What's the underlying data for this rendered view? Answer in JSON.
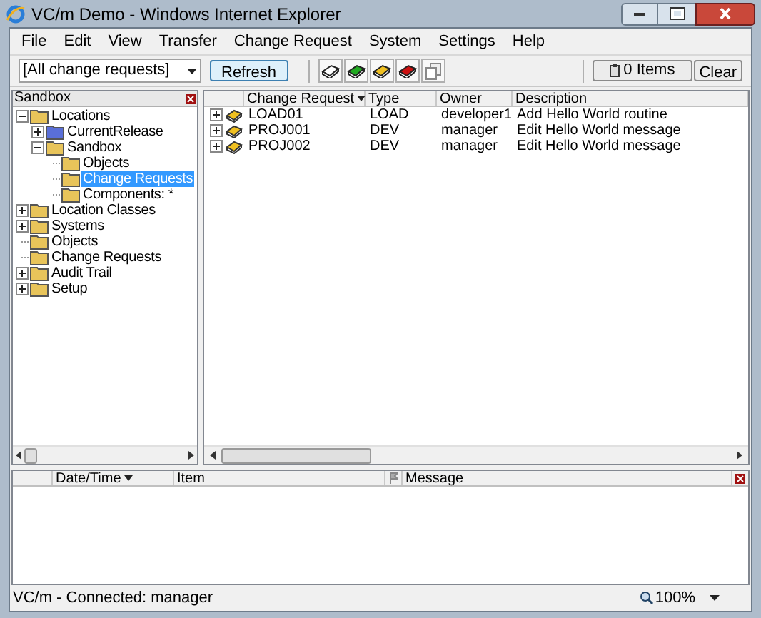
{
  "window": {
    "title": "VC/m Demo - Windows Internet Explorer"
  },
  "menu": [
    "File",
    "Edit",
    "View",
    "Transfer",
    "Change Request",
    "System",
    "Settings",
    "Help"
  ],
  "toolbar": {
    "filter": {
      "value": "[All change requests]"
    },
    "refresh": "Refresh",
    "icon_buttons": [
      {
        "kind": "book",
        "color": "#ffffff"
      },
      {
        "kind": "book",
        "color": "#22aa22"
      },
      {
        "kind": "book",
        "color": "#f0c020"
      },
      {
        "kind": "book",
        "color": "#cc1111"
      },
      {
        "kind": "copy"
      }
    ],
    "items_button": "0 Items",
    "clear": "Clear"
  },
  "tree": {
    "title": "Sandbox",
    "items": [
      {
        "label": "Locations",
        "kind": "branch",
        "expanded": true,
        "color": "#e8c45a",
        "selected": false,
        "children": [
          {
            "label": "CurrentRelease",
            "kind": "branch",
            "expanded": false,
            "color": "#5a6fd8",
            "selected": false
          },
          {
            "label": "Sandbox",
            "kind": "branch",
            "expanded": true,
            "color": "#e8c45a",
            "selected": false,
            "children": [
              {
                "label": "Objects",
                "kind": "leaf",
                "color": "#e8c45a",
                "selected": false
              },
              {
                "label": "Change Requests",
                "kind": "leaf",
                "color": "#e8c45a",
                "selected": true
              },
              {
                "label": "Components: *",
                "kind": "leaf",
                "color": "#e8c45a",
                "selected": false
              }
            ]
          }
        ]
      },
      {
        "label": "Location Classes",
        "kind": "branch",
        "expanded": false,
        "color": "#e8c45a",
        "selected": false
      },
      {
        "label": "Systems",
        "kind": "branch",
        "expanded": false,
        "color": "#e8c45a",
        "selected": false
      },
      {
        "label": "Objects",
        "kind": "leaf",
        "color": "#e8c45a",
        "selected": false
      },
      {
        "label": "Change Requests",
        "kind": "leaf",
        "color": "#e8c45a",
        "selected": false
      },
      {
        "label": "Audit Trail",
        "kind": "branch",
        "expanded": false,
        "color": "#e8c45a",
        "selected": false
      },
      {
        "label": "Setup",
        "kind": "branch",
        "expanded": false,
        "color": "#e8c45a",
        "selected": false
      }
    ]
  },
  "table": {
    "columns": [
      {
        "label": "Change Request",
        "sorted": true
      },
      {
        "label": "Type",
        "sorted": false
      },
      {
        "label": "Owner",
        "sorted": false
      },
      {
        "label": "Description",
        "sorted": false
      }
    ],
    "rows": [
      {
        "expanded": false,
        "cells": [
          "LOAD01",
          "LOAD",
          "developer1",
          "Add Hello World routine"
        ]
      },
      {
        "expanded": false,
        "cells": [
          "PROJ001",
          "DEV",
          "manager",
          "Edit Hello World message"
        ]
      },
      {
        "expanded": false,
        "cells": [
          "PROJ002",
          "DEV",
          "manager",
          "Edit Hello World message"
        ]
      }
    ]
  },
  "log": {
    "columns": [
      {
        "label": "Date/Time",
        "sorted": true
      },
      {
        "label": "Item",
        "sorted": false
      },
      {
        "label": "Message",
        "sorted": false
      }
    ]
  },
  "status_bar": {
    "text": "VC/m - Connected: manager",
    "zoom": "100%"
  }
}
